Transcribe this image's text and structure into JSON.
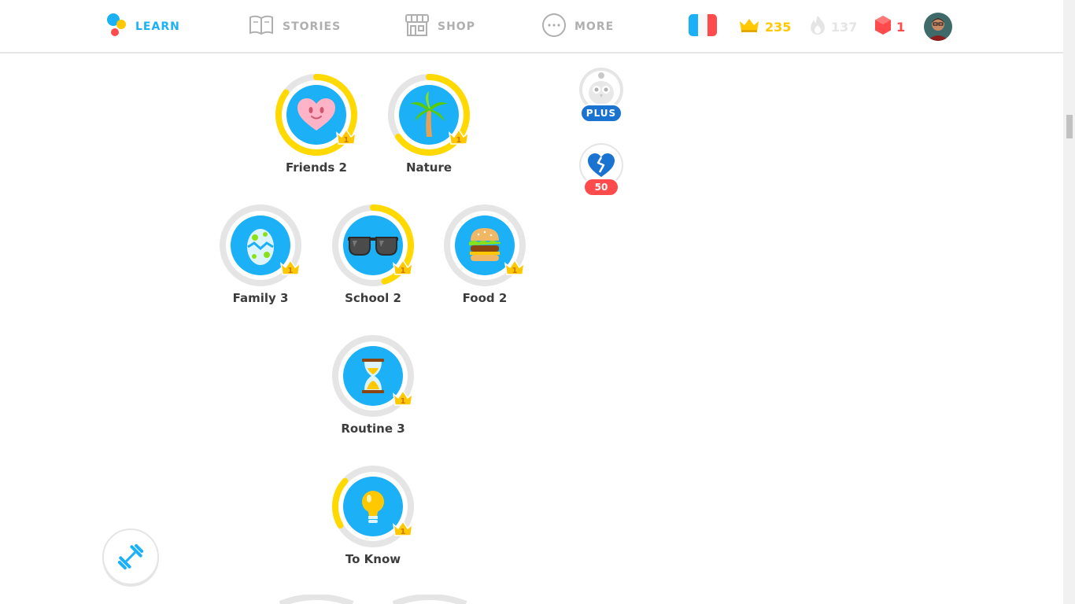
{
  "nav": {
    "learn_label": "LEARN",
    "stories_label": "STORIES",
    "shop_label": "SHOP",
    "more_label": "MORE"
  },
  "stats": {
    "language_flag": "french-flag",
    "crowns": "235",
    "streak": "137",
    "gems": "1"
  },
  "skills": [
    {
      "label": "Friends 2",
      "level": "1",
      "icon": "heart-face-icon",
      "progress": 0.85
    },
    {
      "label": "Nature",
      "level": "1",
      "icon": "palm-tree-icon",
      "progress": 0.65
    },
    {
      "label": "Family 3",
      "level": "1",
      "icon": "egg-icon",
      "progress": 0.0
    },
    {
      "label": "School 2",
      "level": "1",
      "icon": "sunglasses-icon",
      "progress": 0.45
    },
    {
      "label": "Food 2",
      "level": "1",
      "icon": "burger-icon",
      "progress": 0.0
    },
    {
      "label": "Routine 3",
      "level": "1",
      "icon": "hourglass-icon",
      "progress": 0.0
    },
    {
      "label": "To Know",
      "level": "1",
      "icon": "lightbulb-icon",
      "progress": 0.2
    }
  ],
  "side": {
    "plus_label": "PLUS",
    "hearts_count": "50"
  },
  "colors": {
    "accent": "#1cb0f6",
    "gold": "#ffc800",
    "ring_bg": "#e5e5e5",
    "gem_red": "#ff4b4b",
    "plus_blue": "#1a73d0"
  }
}
